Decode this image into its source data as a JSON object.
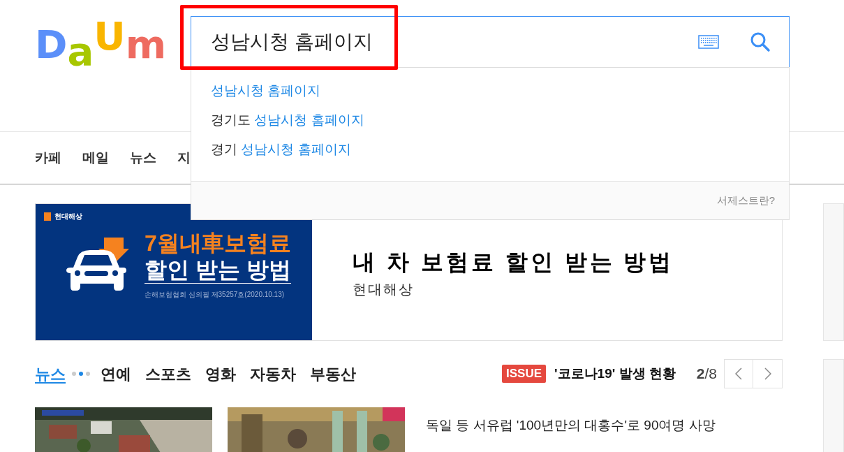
{
  "logo": {
    "letters": [
      "D",
      "a",
      "U",
      "m"
    ]
  },
  "search": {
    "value": "성남시청 홈페이지",
    "highlighted": true
  },
  "suggestions": [
    {
      "match": "성남시청 홈페이지"
    },
    {
      "prefix": "경기도 ",
      "match": "성남시청 홈페이지"
    },
    {
      "prefix": "경기 ",
      "match": "성남시청 홈페이지"
    }
  ],
  "suggest_help": "서제스트란?",
  "nav": [
    "카페",
    "메일",
    "뉴스",
    "지"
  ],
  "ad": {
    "brand": "현대해상",
    "headline_1": "7월내車보험료",
    "headline_2": "할인 받는 방법",
    "fine_print": "손해보험협회 심의필 제35257호(2020.10.13)",
    "title": "내 차 보험료 할인 받는 방법",
    "advertiser": "현대해상"
  },
  "news_tabs": [
    {
      "label": "뉴스",
      "selected": true
    },
    {
      "label": "연예",
      "selected": false
    },
    {
      "label": "스포츠",
      "selected": false
    },
    {
      "label": "영화",
      "selected": false
    },
    {
      "label": "자동차",
      "selected": false
    },
    {
      "label": "부동산",
      "selected": false
    }
  ],
  "issue": {
    "badge": "ISSUE",
    "title": "'코로나19' 발생 현황",
    "page": "2",
    "total": "/8"
  },
  "headlines": [
    "독일 등 서유럽 '100년만의 대홍수'로 90여명 사망"
  ]
}
